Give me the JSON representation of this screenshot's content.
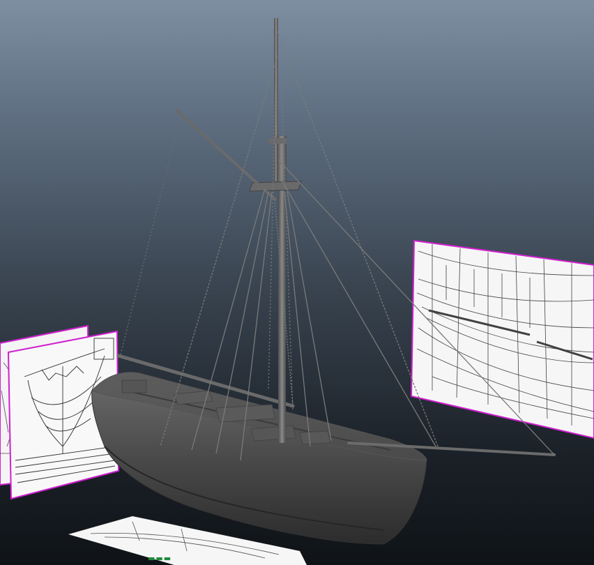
{
  "app": {
    "view": "perspective",
    "background_gradient": [
      "#7e8fa2",
      "#3a4551",
      "#0f1317"
    ],
    "selection_color": "#d020d0",
    "axis_color": "#1e8a3a"
  },
  "scene": {
    "objects": [
      {
        "name": "cutter-hull",
        "kind": "mesh"
      },
      {
        "name": "main-mast",
        "kind": "mesh"
      },
      {
        "name": "gaff-spar",
        "kind": "mesh"
      },
      {
        "name": "boom-spar",
        "kind": "mesh"
      },
      {
        "name": "bowsprit",
        "kind": "mesh"
      },
      {
        "name": "rigging-lines",
        "kind": "curves"
      },
      {
        "name": "reference-plane-right",
        "kind": "image-plane"
      },
      {
        "name": "reference-plane-left-back",
        "kind": "image-plane"
      },
      {
        "name": "reference-plane-left-front",
        "kind": "image-plane"
      },
      {
        "name": "reference-plane-floor",
        "kind": "image-plane"
      }
    ]
  }
}
